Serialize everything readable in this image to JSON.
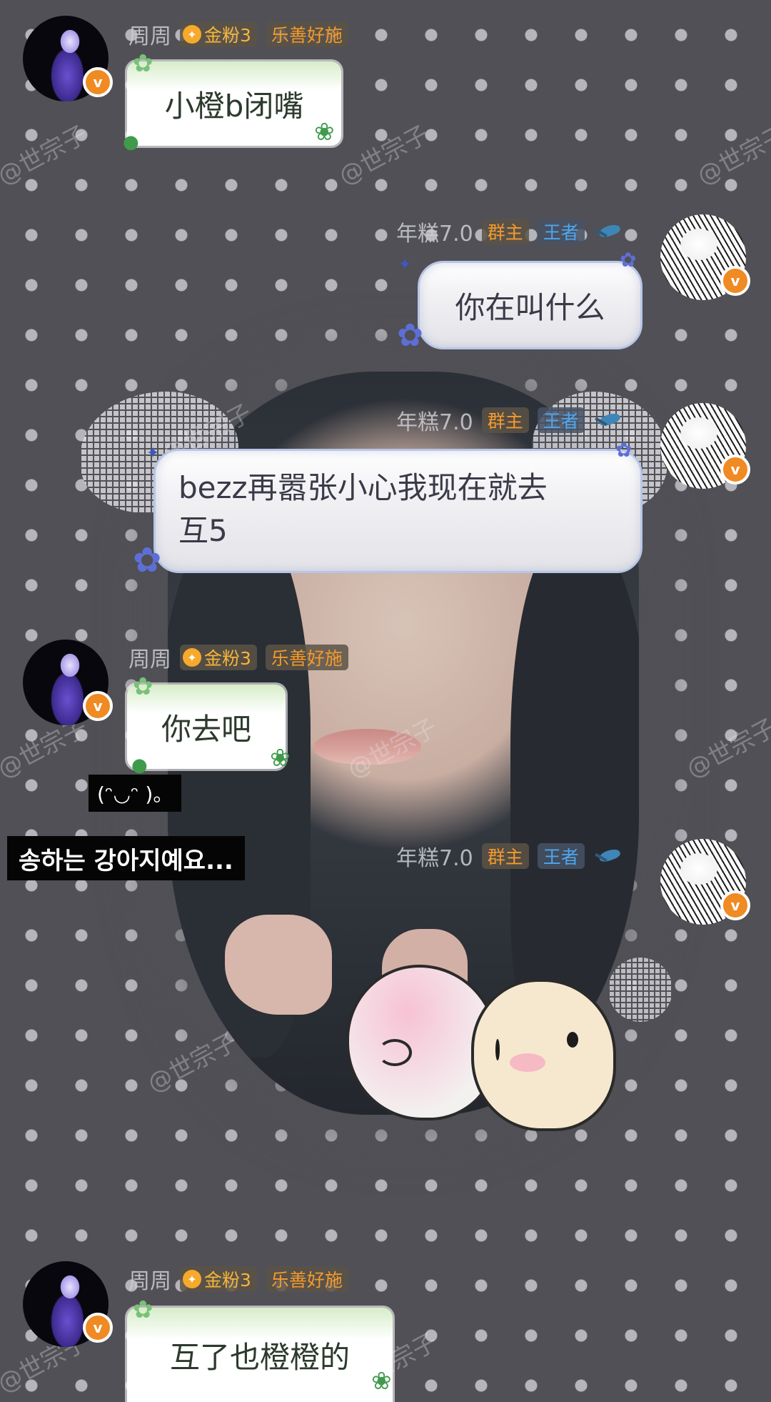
{
  "users": {
    "zhou": {
      "name": "周周",
      "fan_badge": "金粉3",
      "title_badge": "乐善好施",
      "avatar_icon": "purple-figure-avatar",
      "verified_mark": "v"
    },
    "nian": {
      "name": "年糕7.0",
      "role_badge": "群主",
      "rank_badge": "王者",
      "bird_icon": "hummingbird-icon",
      "avatar_icon": "manga-sketch-avatar",
      "verified_mark": "v"
    }
  },
  "messages": [
    {
      "sender": "zhou",
      "text": "小橙b闭嘴",
      "bubble_style": "green-rose"
    },
    {
      "sender": "nian",
      "text": "你在叫什么",
      "bubble_style": "blue-floral"
    },
    {
      "sender": "nian",
      "text_line1": "bezz再嚣张小心我现在就去",
      "text_line2": "互5",
      "bubble_style": "blue-floral"
    },
    {
      "sender": "zhou",
      "text": "你去吧",
      "bubble_style": "green-rose"
    },
    {
      "sender": "nian",
      "sticker": "pink-and-cream-blob-sticker"
    },
    {
      "sender": "zhou",
      "text": "互了也橙橙的",
      "bubble_style": "green-rose"
    }
  ],
  "captions": {
    "kaomoji": "(ᵔ◡ᵔ )。",
    "korean": "송하는 강아지예요..."
  },
  "watermark": "@世宗子",
  "colors": {
    "background": "#505056",
    "dot": "#d7d7dc",
    "verified_badge": "#f08a22",
    "fan_badge_text": "#f6b53a",
    "title_badge_text": "#f49a2c",
    "rank_badge_text": "#4fa6ef"
  }
}
